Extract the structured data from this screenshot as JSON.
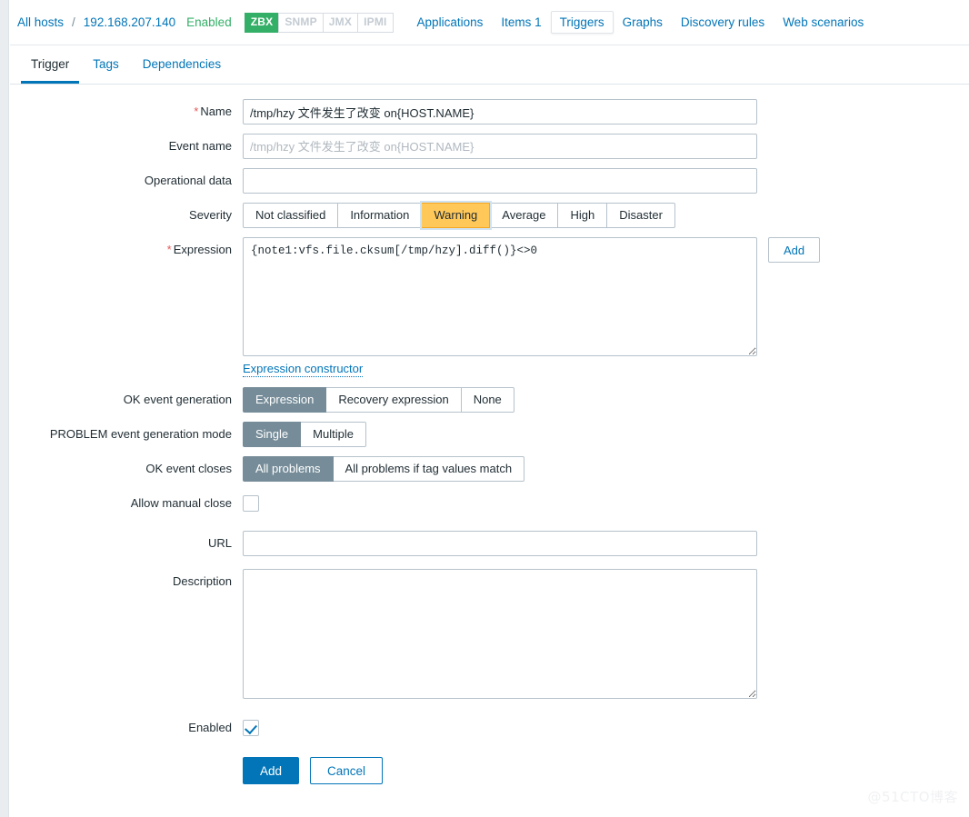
{
  "breadcrumb": {
    "all_hosts": "All hosts",
    "separator": "/",
    "host": "192.168.207.140",
    "status": "Enabled"
  },
  "interface_badges": [
    {
      "label": "ZBX",
      "state": "on"
    },
    {
      "label": "SNMP",
      "state": "off"
    },
    {
      "label": "JMX",
      "state": "off"
    },
    {
      "label": "IPMI",
      "state": "off"
    }
  ],
  "nav_tabs": [
    {
      "label": "Applications",
      "active": false
    },
    {
      "label": "Items 1",
      "active": false
    },
    {
      "label": "Triggers",
      "active": true
    },
    {
      "label": "Graphs",
      "active": false
    },
    {
      "label": "Discovery rules",
      "active": false
    },
    {
      "label": "Web scenarios",
      "active": false
    }
  ],
  "sub_tabs": [
    {
      "label": "Trigger",
      "active": true
    },
    {
      "label": "Tags",
      "active": false
    },
    {
      "label": "Dependencies",
      "active": false
    }
  ],
  "form": {
    "name": {
      "label": "Name",
      "required": true,
      "value": "/tmp/hzy 文件发生了改变 on{HOST.NAME}"
    },
    "event_name": {
      "label": "Event name",
      "value": "",
      "placeholder": "/tmp/hzy 文件发生了改变 on{HOST.NAME}"
    },
    "operational_data": {
      "label": "Operational data",
      "value": "",
      "placeholder": ""
    },
    "severity": {
      "label": "Severity",
      "options": [
        "Not classified",
        "Information",
        "Warning",
        "Average",
        "High",
        "Disaster"
      ],
      "selected": "Warning"
    },
    "expression": {
      "label": "Expression",
      "required": true,
      "value": "{note1:vfs.file.cksum[/tmp/hzy].diff()}<>0",
      "add_button": "Add",
      "constructor_link": "Expression constructor"
    },
    "ok_event_generation": {
      "label": "OK event generation",
      "options": [
        "Expression",
        "Recovery expression",
        "None"
      ],
      "selected": "Expression"
    },
    "problem_event_generation_mode": {
      "label": "PROBLEM event generation mode",
      "options": [
        "Single",
        "Multiple"
      ],
      "selected": "Single"
    },
    "ok_event_closes": {
      "label": "OK event closes",
      "options": [
        "All problems",
        "All problems if tag values match"
      ],
      "selected": "All problems"
    },
    "allow_manual_close": {
      "label": "Allow manual close",
      "checked": false
    },
    "url": {
      "label": "URL",
      "value": "",
      "placeholder": ""
    },
    "description": {
      "label": "Description",
      "value": "",
      "placeholder": ""
    },
    "enabled": {
      "label": "Enabled",
      "checked": true
    }
  },
  "footer": {
    "submit": "Add",
    "cancel": "Cancel"
  },
  "watermark": "@51CTO博客",
  "colors": {
    "link": "#0275b8",
    "enabled_green": "#34af67",
    "severity_warning": "#ffc859",
    "selected_gray": "#768d99",
    "required_red": "#e45959"
  }
}
